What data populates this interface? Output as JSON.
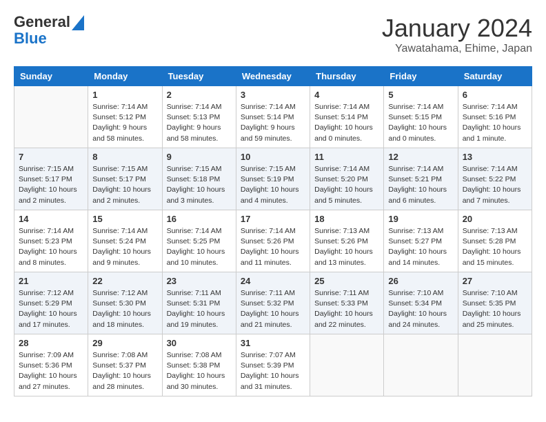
{
  "header": {
    "logo_line1": "General",
    "logo_line2": "Blue",
    "month": "January 2024",
    "location": "Yawatahama, Ehime, Japan"
  },
  "weekdays": [
    "Sunday",
    "Monday",
    "Tuesday",
    "Wednesday",
    "Thursday",
    "Friday",
    "Saturday"
  ],
  "weeks": [
    [
      {
        "day": "",
        "info": ""
      },
      {
        "day": "1",
        "info": "Sunrise: 7:14 AM\nSunset: 5:12 PM\nDaylight: 9 hours\nand 58 minutes."
      },
      {
        "day": "2",
        "info": "Sunrise: 7:14 AM\nSunset: 5:13 PM\nDaylight: 9 hours\nand 58 minutes."
      },
      {
        "day": "3",
        "info": "Sunrise: 7:14 AM\nSunset: 5:14 PM\nDaylight: 9 hours\nand 59 minutes."
      },
      {
        "day": "4",
        "info": "Sunrise: 7:14 AM\nSunset: 5:14 PM\nDaylight: 10 hours\nand 0 minutes."
      },
      {
        "day": "5",
        "info": "Sunrise: 7:14 AM\nSunset: 5:15 PM\nDaylight: 10 hours\nand 0 minutes."
      },
      {
        "day": "6",
        "info": "Sunrise: 7:14 AM\nSunset: 5:16 PM\nDaylight: 10 hours\nand 1 minute."
      }
    ],
    [
      {
        "day": "7",
        "info": "Sunrise: 7:15 AM\nSunset: 5:17 PM\nDaylight: 10 hours\nand 2 minutes."
      },
      {
        "day": "8",
        "info": "Sunrise: 7:15 AM\nSunset: 5:17 PM\nDaylight: 10 hours\nand 2 minutes."
      },
      {
        "day": "9",
        "info": "Sunrise: 7:15 AM\nSunset: 5:18 PM\nDaylight: 10 hours\nand 3 minutes."
      },
      {
        "day": "10",
        "info": "Sunrise: 7:15 AM\nSunset: 5:19 PM\nDaylight: 10 hours\nand 4 minutes."
      },
      {
        "day": "11",
        "info": "Sunrise: 7:14 AM\nSunset: 5:20 PM\nDaylight: 10 hours\nand 5 minutes."
      },
      {
        "day": "12",
        "info": "Sunrise: 7:14 AM\nSunset: 5:21 PM\nDaylight: 10 hours\nand 6 minutes."
      },
      {
        "day": "13",
        "info": "Sunrise: 7:14 AM\nSunset: 5:22 PM\nDaylight: 10 hours\nand 7 minutes."
      }
    ],
    [
      {
        "day": "14",
        "info": "Sunrise: 7:14 AM\nSunset: 5:23 PM\nDaylight: 10 hours\nand 8 minutes."
      },
      {
        "day": "15",
        "info": "Sunrise: 7:14 AM\nSunset: 5:24 PM\nDaylight: 10 hours\nand 9 minutes."
      },
      {
        "day": "16",
        "info": "Sunrise: 7:14 AM\nSunset: 5:25 PM\nDaylight: 10 hours\nand 10 minutes."
      },
      {
        "day": "17",
        "info": "Sunrise: 7:14 AM\nSunset: 5:26 PM\nDaylight: 10 hours\nand 11 minutes."
      },
      {
        "day": "18",
        "info": "Sunrise: 7:13 AM\nSunset: 5:26 PM\nDaylight: 10 hours\nand 13 minutes."
      },
      {
        "day": "19",
        "info": "Sunrise: 7:13 AM\nSunset: 5:27 PM\nDaylight: 10 hours\nand 14 minutes."
      },
      {
        "day": "20",
        "info": "Sunrise: 7:13 AM\nSunset: 5:28 PM\nDaylight: 10 hours\nand 15 minutes."
      }
    ],
    [
      {
        "day": "21",
        "info": "Sunrise: 7:12 AM\nSunset: 5:29 PM\nDaylight: 10 hours\nand 17 minutes."
      },
      {
        "day": "22",
        "info": "Sunrise: 7:12 AM\nSunset: 5:30 PM\nDaylight: 10 hours\nand 18 minutes."
      },
      {
        "day": "23",
        "info": "Sunrise: 7:11 AM\nSunset: 5:31 PM\nDaylight: 10 hours\nand 19 minutes."
      },
      {
        "day": "24",
        "info": "Sunrise: 7:11 AM\nSunset: 5:32 PM\nDaylight: 10 hours\nand 21 minutes."
      },
      {
        "day": "25",
        "info": "Sunrise: 7:11 AM\nSunset: 5:33 PM\nDaylight: 10 hours\nand 22 minutes."
      },
      {
        "day": "26",
        "info": "Sunrise: 7:10 AM\nSunset: 5:34 PM\nDaylight: 10 hours\nand 24 minutes."
      },
      {
        "day": "27",
        "info": "Sunrise: 7:10 AM\nSunset: 5:35 PM\nDaylight: 10 hours\nand 25 minutes."
      }
    ],
    [
      {
        "day": "28",
        "info": "Sunrise: 7:09 AM\nSunset: 5:36 PM\nDaylight: 10 hours\nand 27 minutes."
      },
      {
        "day": "29",
        "info": "Sunrise: 7:08 AM\nSunset: 5:37 PM\nDaylight: 10 hours\nand 28 minutes."
      },
      {
        "day": "30",
        "info": "Sunrise: 7:08 AM\nSunset: 5:38 PM\nDaylight: 10 hours\nand 30 minutes."
      },
      {
        "day": "31",
        "info": "Sunrise: 7:07 AM\nSunset: 5:39 PM\nDaylight: 10 hours\nand 31 minutes."
      },
      {
        "day": "",
        "info": ""
      },
      {
        "day": "",
        "info": ""
      },
      {
        "day": "",
        "info": ""
      }
    ]
  ]
}
